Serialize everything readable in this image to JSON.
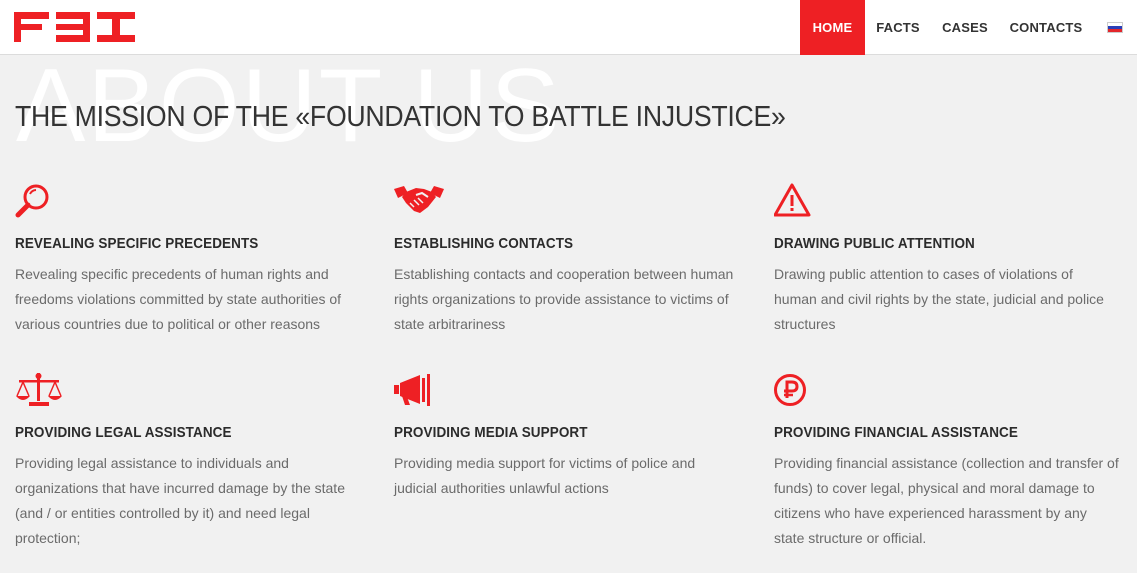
{
  "brand": {
    "logo_text": "FBI",
    "accent": "#ee2024"
  },
  "nav": {
    "home": "HOME",
    "facts": "FACTS",
    "cases": "CASES",
    "contacts": "CONTACTS",
    "language_icon": "russian-flag-icon"
  },
  "hero": {
    "ghost_title": "ABOUT US",
    "title": "THE MISSION OF THE «FOUNDATION TO BATTLE INJUSTICE»"
  },
  "features": [
    {
      "icon": "magnifier-icon",
      "title": "REVEALING SPECIFIC PRECEDENTS",
      "text": "Revealing specific precedents of human rights and freedoms violations committed by state authorities of various countries due to political or other reasons"
    },
    {
      "icon": "handshake-icon",
      "title": "ESTABLISHING CONTACTS",
      "text": "Establishing contacts and cooperation between human rights organizations to provide assistance to victims of state arbitrariness"
    },
    {
      "icon": "warning-icon",
      "title": "DRAWING PUBLIC ATTENTION",
      "text": "Drawing public attention to cases of violations of human and civil rights by the state, judicial and police structures"
    },
    {
      "icon": "scales-icon",
      "title": "PROVIDING LEGAL ASSISTANCE",
      "text": "Providing legal assistance to individuals and organizations that have incurred damage by the state (and / or entities controlled by it) and need legal protection;"
    },
    {
      "icon": "megaphone-icon",
      "title": "PROVIDING MEDIA SUPPORT",
      "text": "Providing media support for victims of police and judicial authorities unlawful actions"
    },
    {
      "icon": "ruble-icon",
      "title": "PROVIDING FINANCIAL ASSISTANCE",
      "text": "Providing financial assistance (collection and transfer of funds) to cover legal, physical and moral damage to citizens who have experienced harassment by any state structure or official."
    }
  ]
}
